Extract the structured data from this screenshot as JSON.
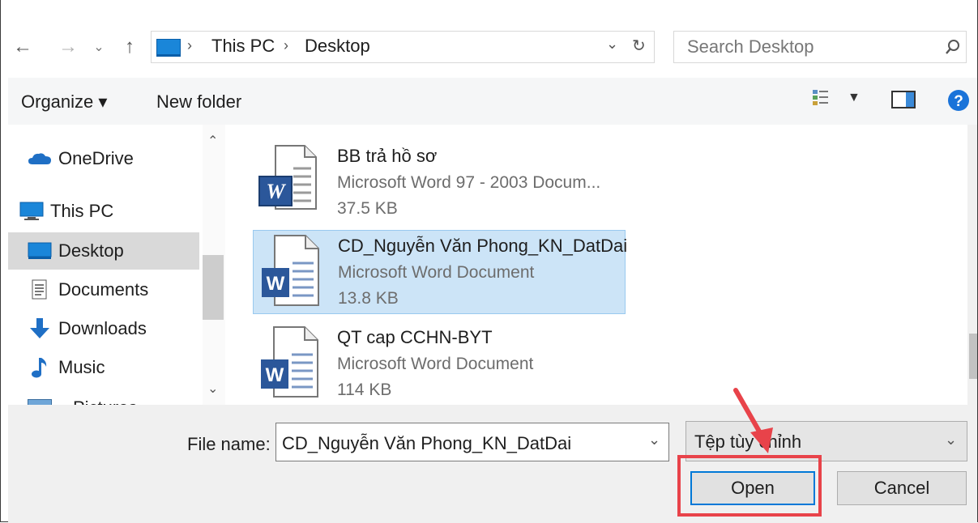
{
  "address": {
    "crumbs": [
      "This PC",
      "Desktop"
    ],
    "search_placeholder": "Search Desktop"
  },
  "toolbar": {
    "organize_label": "Organize ▾",
    "new_folder_label": "New folder"
  },
  "nav": {
    "items": [
      {
        "label": "OneDrive"
      },
      {
        "label": "This PC"
      },
      {
        "label": "Desktop",
        "selected": true
      },
      {
        "label": "Documents"
      },
      {
        "label": "Downloads"
      },
      {
        "label": "Music"
      },
      {
        "label": "Pictures"
      }
    ]
  },
  "files": [
    {
      "name": "BB trả hồ sơ",
      "type": "Microsoft Word 97 - 2003 Docum...",
      "size": "37.5 KB"
    },
    {
      "name": "CD_Nguyễn Văn Phong_KN_DatDai",
      "type": "Microsoft Word Document",
      "size": "13.8 KB",
      "selected": true
    },
    {
      "name": "QT cap CCHN-BYT",
      "type": "Microsoft Word Document",
      "size": "114 KB"
    }
  ],
  "footer": {
    "file_name_label": "File name:",
    "file_name_value": "CD_Nguyễn Văn Phong_KN_DatDai",
    "filter_value": "Tệp tùy chỉnh",
    "open_label": "Open",
    "cancel_label": "Cancel"
  },
  "colors": {
    "accent": "#0078d7",
    "selection_bg": "#cce4f7",
    "highlight": "#e8434a",
    "word_blue": "#2b579a"
  }
}
